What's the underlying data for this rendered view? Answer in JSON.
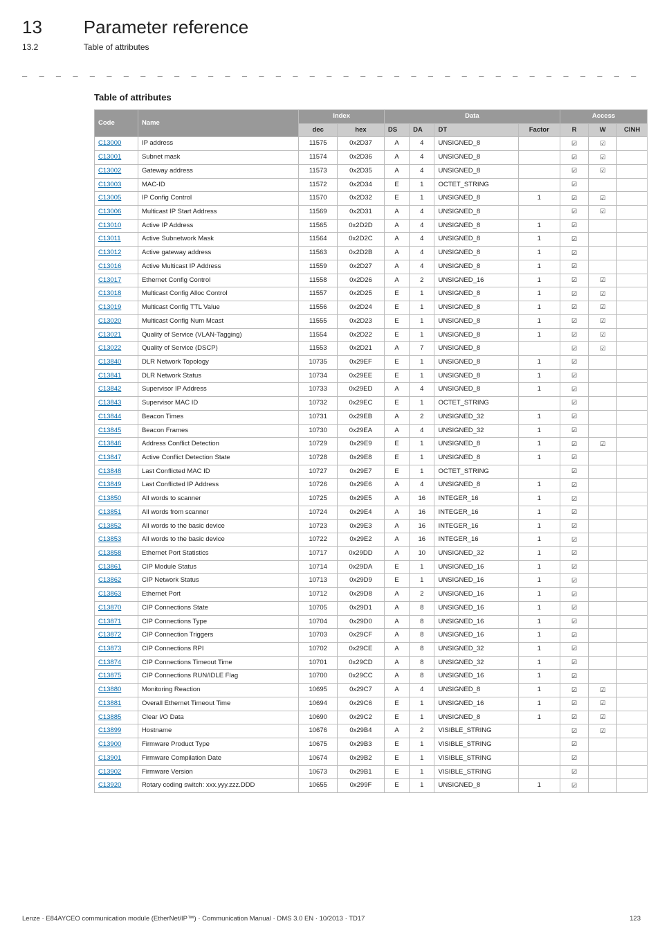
{
  "header": {
    "chapter_num": "13",
    "chapter_title": "Parameter reference",
    "section_num": "13.2",
    "section_title": "Table of attributes"
  },
  "table_heading": "Table of attributes",
  "columns": {
    "top": {
      "code": "Code",
      "name": "Name",
      "index": "Index",
      "data": "Data",
      "access": "Access"
    },
    "sub": {
      "dec": "dec",
      "hex": "hex",
      "ds": "DS",
      "da": "DA",
      "dt": "DT",
      "factor": "Factor",
      "r": "R",
      "w": "W",
      "cinh": "CINH"
    }
  },
  "rows": [
    {
      "code": "C13000",
      "name": "IP address",
      "dec": "11575",
      "hex": "0x2D37",
      "ds": "A",
      "da": "4",
      "dt": "UNSIGNED_8",
      "factor": "",
      "r": true,
      "w": true,
      "cinh": false
    },
    {
      "code": "C13001",
      "name": "Subnet mask",
      "dec": "11574",
      "hex": "0x2D36",
      "ds": "A",
      "da": "4",
      "dt": "UNSIGNED_8",
      "factor": "",
      "r": true,
      "w": true,
      "cinh": false
    },
    {
      "code": "C13002",
      "name": "Gateway address",
      "dec": "11573",
      "hex": "0x2D35",
      "ds": "A",
      "da": "4",
      "dt": "UNSIGNED_8",
      "factor": "",
      "r": true,
      "w": true,
      "cinh": false
    },
    {
      "code": "C13003",
      "name": "MAC-ID",
      "dec": "11572",
      "hex": "0x2D34",
      "ds": "E",
      "da": "1",
      "dt": "OCTET_STRING",
      "factor": "",
      "r": true,
      "w": false,
      "cinh": false
    },
    {
      "code": "C13005",
      "name": "IP Config Control",
      "dec": "11570",
      "hex": "0x2D32",
      "ds": "E",
      "da": "1",
      "dt": "UNSIGNED_8",
      "factor": "1",
      "r": true,
      "w": true,
      "cinh": false
    },
    {
      "code": "C13006",
      "name": "Multicast IP Start Address",
      "dec": "11569",
      "hex": "0x2D31",
      "ds": "A",
      "da": "4",
      "dt": "UNSIGNED_8",
      "factor": "",
      "r": true,
      "w": true,
      "cinh": false
    },
    {
      "code": "C13010",
      "name": "Active IP Address",
      "dec": "11565",
      "hex": "0x2D2D",
      "ds": "A",
      "da": "4",
      "dt": "UNSIGNED_8",
      "factor": "1",
      "r": true,
      "w": false,
      "cinh": false
    },
    {
      "code": "C13011",
      "name": "Active Subnetwork Mask",
      "dec": "11564",
      "hex": "0x2D2C",
      "ds": "A",
      "da": "4",
      "dt": "UNSIGNED_8",
      "factor": "1",
      "r": true,
      "w": false,
      "cinh": false
    },
    {
      "code": "C13012",
      "name": "Active gateway address",
      "dec": "11563",
      "hex": "0x2D2B",
      "ds": "A",
      "da": "4",
      "dt": "UNSIGNED_8",
      "factor": "1",
      "r": true,
      "w": false,
      "cinh": false
    },
    {
      "code": "C13016",
      "name": "Active Multicast IP Address",
      "dec": "11559",
      "hex": "0x2D27",
      "ds": "A",
      "da": "4",
      "dt": "UNSIGNED_8",
      "factor": "1",
      "r": true,
      "w": false,
      "cinh": false
    },
    {
      "code": "C13017",
      "name": "Ethernet Config Control",
      "dec": "11558",
      "hex": "0x2D26",
      "ds": "A",
      "da": "2",
      "dt": "UNSIGNED_16",
      "factor": "1",
      "r": true,
      "w": true,
      "cinh": false
    },
    {
      "code": "C13018",
      "name": "Multicast Config Alloc Control",
      "dec": "11557",
      "hex": "0x2D25",
      "ds": "E",
      "da": "1",
      "dt": "UNSIGNED_8",
      "factor": "1",
      "r": true,
      "w": true,
      "cinh": false
    },
    {
      "code": "C13019",
      "name": "Multicast Config TTL Value",
      "dec": "11556",
      "hex": "0x2D24",
      "ds": "E",
      "da": "1",
      "dt": "UNSIGNED_8",
      "factor": "1",
      "r": true,
      "w": true,
      "cinh": false
    },
    {
      "code": "C13020",
      "name": "Multicast Config Num Mcast",
      "dec": "11555",
      "hex": "0x2D23",
      "ds": "E",
      "da": "1",
      "dt": "UNSIGNED_8",
      "factor": "1",
      "r": true,
      "w": true,
      "cinh": false
    },
    {
      "code": "C13021",
      "name": "Quality of Service (VLAN-Tagging)",
      "dec": "11554",
      "hex": "0x2D22",
      "ds": "E",
      "da": "1",
      "dt": "UNSIGNED_8",
      "factor": "1",
      "r": true,
      "w": true,
      "cinh": false
    },
    {
      "code": "C13022",
      "name": "Quality of Service (DSCP)",
      "dec": "11553",
      "hex": "0x2D21",
      "ds": "A",
      "da": "7",
      "dt": "UNSIGNED_8",
      "factor": "",
      "r": true,
      "w": true,
      "cinh": false
    },
    {
      "code": "C13840",
      "name": "DLR Network Topology",
      "dec": "10735",
      "hex": "0x29EF",
      "ds": "E",
      "da": "1",
      "dt": "UNSIGNED_8",
      "factor": "1",
      "r": true,
      "w": false,
      "cinh": false
    },
    {
      "code": "C13841",
      "name": "DLR Network Status",
      "dec": "10734",
      "hex": "0x29EE",
      "ds": "E",
      "da": "1",
      "dt": "UNSIGNED_8",
      "factor": "1",
      "r": true,
      "w": false,
      "cinh": false
    },
    {
      "code": "C13842",
      "name": "Supervisor IP Address",
      "dec": "10733",
      "hex": "0x29ED",
      "ds": "A",
      "da": "4",
      "dt": "UNSIGNED_8",
      "factor": "1",
      "r": true,
      "w": false,
      "cinh": false
    },
    {
      "code": "C13843",
      "name": "Supervisor MAC ID",
      "dec": "10732",
      "hex": "0x29EC",
      "ds": "E",
      "da": "1",
      "dt": "OCTET_STRING",
      "factor": "",
      "r": true,
      "w": false,
      "cinh": false
    },
    {
      "code": "C13844",
      "name": "Beacon Times",
      "dec": "10731",
      "hex": "0x29EB",
      "ds": "A",
      "da": "2",
      "dt": "UNSIGNED_32",
      "factor": "1",
      "r": true,
      "w": false,
      "cinh": false
    },
    {
      "code": "C13845",
      "name": "Beacon Frames",
      "dec": "10730",
      "hex": "0x29EA",
      "ds": "A",
      "da": "4",
      "dt": "UNSIGNED_32",
      "factor": "1",
      "r": true,
      "w": false,
      "cinh": false
    },
    {
      "code": "C13846",
      "name": "Address Conflict Detection",
      "dec": "10729",
      "hex": "0x29E9",
      "ds": "E",
      "da": "1",
      "dt": "UNSIGNED_8",
      "factor": "1",
      "r": true,
      "w": true,
      "cinh": false
    },
    {
      "code": "C13847",
      "name": "Active Conflict Detection State",
      "dec": "10728",
      "hex": "0x29E8",
      "ds": "E",
      "da": "1",
      "dt": "UNSIGNED_8",
      "factor": "1",
      "r": true,
      "w": false,
      "cinh": false
    },
    {
      "code": "C13848",
      "name": "Last Conflicted MAC ID",
      "dec": "10727",
      "hex": "0x29E7",
      "ds": "E",
      "da": "1",
      "dt": "OCTET_STRING",
      "factor": "",
      "r": true,
      "w": false,
      "cinh": false
    },
    {
      "code": "C13849",
      "name": "Last Conflicted IP Address",
      "dec": "10726",
      "hex": "0x29E6",
      "ds": "A",
      "da": "4",
      "dt": "UNSIGNED_8",
      "factor": "1",
      "r": true,
      "w": false,
      "cinh": false
    },
    {
      "code": "C13850",
      "name": "All words to scanner",
      "dec": "10725",
      "hex": "0x29E5",
      "ds": "A",
      "da": "16",
      "dt": "INTEGER_16",
      "factor": "1",
      "r": true,
      "w": false,
      "cinh": false
    },
    {
      "code": "C13851",
      "name": "All words from scanner",
      "dec": "10724",
      "hex": "0x29E4",
      "ds": "A",
      "da": "16",
      "dt": "INTEGER_16",
      "factor": "1",
      "r": true,
      "w": false,
      "cinh": false
    },
    {
      "code": "C13852",
      "name": "All words to the basic device",
      "dec": "10723",
      "hex": "0x29E3",
      "ds": "A",
      "da": "16",
      "dt": "INTEGER_16",
      "factor": "1",
      "r": true,
      "w": false,
      "cinh": false
    },
    {
      "code": "C13853",
      "name": "All words to the basic device",
      "dec": "10722",
      "hex": "0x29E2",
      "ds": "A",
      "da": "16",
      "dt": "INTEGER_16",
      "factor": "1",
      "r": true,
      "w": false,
      "cinh": false
    },
    {
      "code": "C13858",
      "name": "Ethernet Port Statistics",
      "dec": "10717",
      "hex": "0x29DD",
      "ds": "A",
      "da": "10",
      "dt": "UNSIGNED_32",
      "factor": "1",
      "r": true,
      "w": false,
      "cinh": false
    },
    {
      "code": "C13861",
      "name": "CIP Module Status",
      "dec": "10714",
      "hex": "0x29DA",
      "ds": "E",
      "da": "1",
      "dt": "UNSIGNED_16",
      "factor": "1",
      "r": true,
      "w": false,
      "cinh": false
    },
    {
      "code": "C13862",
      "name": "CIP Network Status",
      "dec": "10713",
      "hex": "0x29D9",
      "ds": "E",
      "da": "1",
      "dt": "UNSIGNED_16",
      "factor": "1",
      "r": true,
      "w": false,
      "cinh": false
    },
    {
      "code": "C13863",
      "name": "Ethernet Port",
      "dec": "10712",
      "hex": "0x29D8",
      "ds": "A",
      "da": "2",
      "dt": "UNSIGNED_16",
      "factor": "1",
      "r": true,
      "w": false,
      "cinh": false
    },
    {
      "code": "C13870",
      "name": "CIP Connections State",
      "dec": "10705",
      "hex": "0x29D1",
      "ds": "A",
      "da": "8",
      "dt": "UNSIGNED_16",
      "factor": "1",
      "r": true,
      "w": false,
      "cinh": false
    },
    {
      "code": "C13871",
      "name": "CIP Connections Type",
      "dec": "10704",
      "hex": "0x29D0",
      "ds": "A",
      "da": "8",
      "dt": "UNSIGNED_16",
      "factor": "1",
      "r": true,
      "w": false,
      "cinh": false
    },
    {
      "code": "C13872",
      "name": "CIP Connection Triggers",
      "dec": "10703",
      "hex": "0x29CF",
      "ds": "A",
      "da": "8",
      "dt": "UNSIGNED_16",
      "factor": "1",
      "r": true,
      "w": false,
      "cinh": false
    },
    {
      "code": "C13873",
      "name": "CIP Connections RPI",
      "dec": "10702",
      "hex": "0x29CE",
      "ds": "A",
      "da": "8",
      "dt": "UNSIGNED_32",
      "factor": "1",
      "r": true,
      "w": false,
      "cinh": false
    },
    {
      "code": "C13874",
      "name": "CIP Connections Timeout Time",
      "dec": "10701",
      "hex": "0x29CD",
      "ds": "A",
      "da": "8",
      "dt": "UNSIGNED_32",
      "factor": "1",
      "r": true,
      "w": false,
      "cinh": false
    },
    {
      "code": "C13875",
      "name": "CIP Connections RUN/IDLE Flag",
      "dec": "10700",
      "hex": "0x29CC",
      "ds": "A",
      "da": "8",
      "dt": "UNSIGNED_16",
      "factor": "1",
      "r": true,
      "w": false,
      "cinh": false
    },
    {
      "code": "C13880",
      "name": "Monitoring Reaction",
      "dec": "10695",
      "hex": "0x29C7",
      "ds": "A",
      "da": "4",
      "dt": "UNSIGNED_8",
      "factor": "1",
      "r": true,
      "w": true,
      "cinh": false
    },
    {
      "code": "C13881",
      "name": "Overall Ethernet Timeout Time",
      "dec": "10694",
      "hex": "0x29C6",
      "ds": "E",
      "da": "1",
      "dt": "UNSIGNED_16",
      "factor": "1",
      "r": true,
      "w": true,
      "cinh": false
    },
    {
      "code": "C13885",
      "name": "Clear I/O Data",
      "dec": "10690",
      "hex": "0x29C2",
      "ds": "E",
      "da": "1",
      "dt": "UNSIGNED_8",
      "factor": "1",
      "r": true,
      "w": true,
      "cinh": false
    },
    {
      "code": "C13899",
      "name": "Hostname",
      "dec": "10676",
      "hex": "0x29B4",
      "ds": "A",
      "da": "2",
      "dt": "VISIBLE_STRING",
      "factor": "",
      "r": true,
      "w": true,
      "cinh": false
    },
    {
      "code": "C13900",
      "name": "Firmware Product Type",
      "dec": "10675",
      "hex": "0x29B3",
      "ds": "E",
      "da": "1",
      "dt": "VISIBLE_STRING",
      "factor": "",
      "r": true,
      "w": false,
      "cinh": false
    },
    {
      "code": "C13901",
      "name": "Firmware Compilation Date",
      "dec": "10674",
      "hex": "0x29B2",
      "ds": "E",
      "da": "1",
      "dt": "VISIBLE_STRING",
      "factor": "",
      "r": true,
      "w": false,
      "cinh": false
    },
    {
      "code": "C13902",
      "name": "Firmware Version",
      "dec": "10673",
      "hex": "0x29B1",
      "ds": "E",
      "da": "1",
      "dt": "VISIBLE_STRING",
      "factor": "",
      "r": true,
      "w": false,
      "cinh": false
    },
    {
      "code": "C13920",
      "name": "Rotary coding switch: xxx.yyy.zzz.DDD",
      "dec": "10655",
      "hex": "0x299F",
      "ds": "E",
      "da": "1",
      "dt": "UNSIGNED_8",
      "factor": "1",
      "r": true,
      "w": false,
      "cinh": false
    }
  ],
  "footer": {
    "left": "Lenze · E84AYCEO communication module (EtherNet/IP™) · Communication Manual · DMS 3.0 EN · 10/2013 · TD17",
    "right": "123"
  },
  "check_glyph": "☑"
}
